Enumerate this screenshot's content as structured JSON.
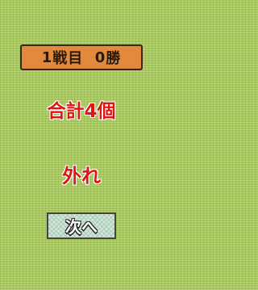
{
  "score": {
    "battle_count": "1",
    "battle_label": "戦目",
    "win_count": "0",
    "win_label": "勝"
  },
  "result": {
    "hits_text": "合計4個",
    "outcome_text": "外れ"
  },
  "controls": {
    "next_label": "次へ"
  },
  "colors": {
    "background": "#a6c85a",
    "banner": "#e2893c",
    "text_red": "#e1140f",
    "button": "#cfe6d6"
  }
}
